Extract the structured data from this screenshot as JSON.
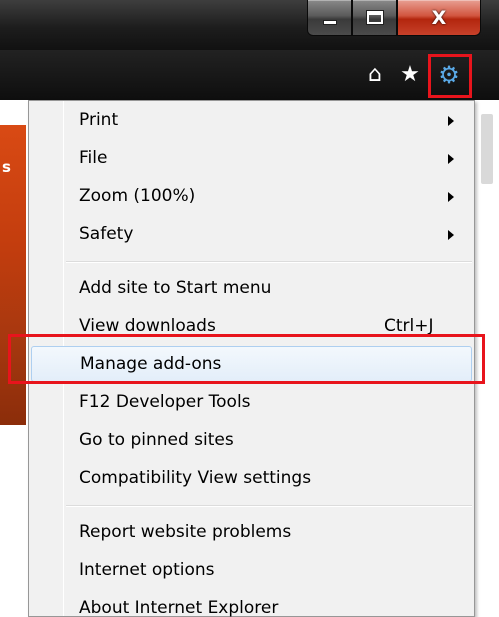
{
  "window_controls": {
    "minimize_icon": "minimize-icon",
    "maximize_icon": "maximize-icon",
    "close_glyph": "X"
  },
  "toolbar": {
    "home_glyph": "⌂",
    "favorites_glyph": "★",
    "tools_glyph": "⚙",
    "tools_color": "#5aa9e6"
  },
  "page": {
    "visible_letter": "s",
    "accent_color": "#c33d0e"
  },
  "menu": {
    "groups": [
      [
        {
          "label": "Print",
          "submenu": true
        },
        {
          "label": "File",
          "submenu": true
        },
        {
          "label": "Zoom (100%)",
          "submenu": true
        },
        {
          "label": "Safety",
          "submenu": true
        }
      ],
      [
        {
          "label": "Add site to Start menu"
        },
        {
          "label": "View downloads",
          "shortcut": "Ctrl+J"
        },
        {
          "label": "Manage add-ons",
          "state": "hover",
          "highlighted": true
        },
        {
          "label": "F12 Developer Tools"
        },
        {
          "label": "Go to pinned sites"
        },
        {
          "label": "Compatibility View settings"
        }
      ],
      [
        {
          "label": "Report website problems"
        },
        {
          "label": "Internet options"
        },
        {
          "label": "About Internet Explorer"
        }
      ]
    ]
  },
  "colors": {
    "highlight_box": "#e8141c",
    "menu_background": "#f1f1f1",
    "hover_border": "#aecff0"
  }
}
